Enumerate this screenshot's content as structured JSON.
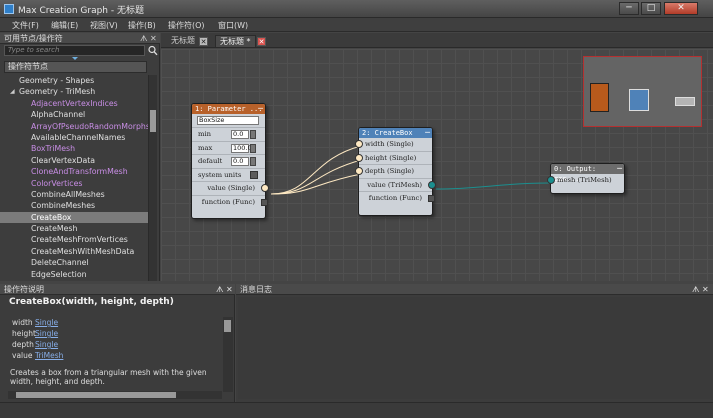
{
  "window": {
    "title": "Max Creation Graph - 无标题",
    "min": "─",
    "max": "□",
    "close": "✕"
  },
  "menu": [
    "文件(F)",
    "编辑(E)",
    "视图(V)",
    "操作(B)",
    "操作符(O)",
    "窗口(W)"
  ],
  "left_panel": {
    "title": "可用节点/操作符",
    "search_placeholder": "Type to search",
    "category_header": "操作符节点",
    "items": [
      {
        "label": "Geometry - Shapes",
        "kind": "group"
      },
      {
        "label": "Geometry - TriMesh",
        "kind": "group"
      },
      {
        "label": "AdjacentVertexIndices",
        "kind": "purple"
      },
      {
        "label": "AlphaChannel",
        "kind": "normal"
      },
      {
        "label": "ArrayOfPseudoRandomMorphs",
        "kind": "purple"
      },
      {
        "label": "AvailableChannelNames",
        "kind": "normal"
      },
      {
        "label": "BoxTriMesh",
        "kind": "purple"
      },
      {
        "label": "ClearVertexData",
        "kind": "normal"
      },
      {
        "label": "CloneAndTransformMesh",
        "kind": "purple"
      },
      {
        "label": "ColorVertices",
        "kind": "purple"
      },
      {
        "label": "CombineAllMeshes",
        "kind": "normal"
      },
      {
        "label": "CombineMeshes",
        "kind": "normal"
      },
      {
        "label": "CreateBox",
        "kind": "selected"
      },
      {
        "label": "CreateMesh",
        "kind": "normal"
      },
      {
        "label": "CreateMeshFromVertices",
        "kind": "normal"
      },
      {
        "label": "CreateMeshWithMeshData",
        "kind": "normal"
      },
      {
        "label": "DeleteChannel",
        "kind": "normal"
      },
      {
        "label": "EdgeSelection",
        "kind": "normal"
      }
    ]
  },
  "tabs": [
    {
      "label": "无标题",
      "active": false
    },
    {
      "label": "无标题 *",
      "active": true
    }
  ],
  "nodes": {
    "parameter": {
      "title": "1: Parameter ...",
      "name_value": "BoxSize",
      "min_label": "min",
      "min_value": "0.0",
      "max_label": "max",
      "max_value": "100.0",
      "default_label": "default",
      "default_value": "0.0",
      "units_label": "system units",
      "value_label": "value (Single)",
      "function_label": "function (Func)"
    },
    "createbox": {
      "title": "2: CreateBox",
      "width_label": "width (Single)",
      "height_label": "height (Single)",
      "depth_label": "depth (Single)",
      "value_label": "value (TriMesh)",
      "function_label": "function (Func)"
    },
    "output": {
      "title": "0: Output: geo...",
      "mesh_label": "mesh (TriMesh)"
    }
  },
  "desc_panel": {
    "title": "操作符说明",
    "signature": "CreateBox(width, height, depth)",
    "params": [
      {
        "name": "width",
        "type": "Single"
      },
      {
        "name": "height",
        "type": "Single"
      },
      {
        "name": "depth",
        "type": "Single"
      },
      {
        "name": "value",
        "type": "TriMesh"
      }
    ],
    "text": "Creates a box from a triangular mesh with the given width, height, and depth."
  },
  "log_panel": {
    "title": "消息日志"
  },
  "colors": {
    "param_header": "#b8612a",
    "createbox_header": "#4f82b8",
    "output_header": "#6c6c6c",
    "mesh_port": "#1b8f8f",
    "single_port": "#fde8c2",
    "purple_item": "#c98ee6"
  }
}
